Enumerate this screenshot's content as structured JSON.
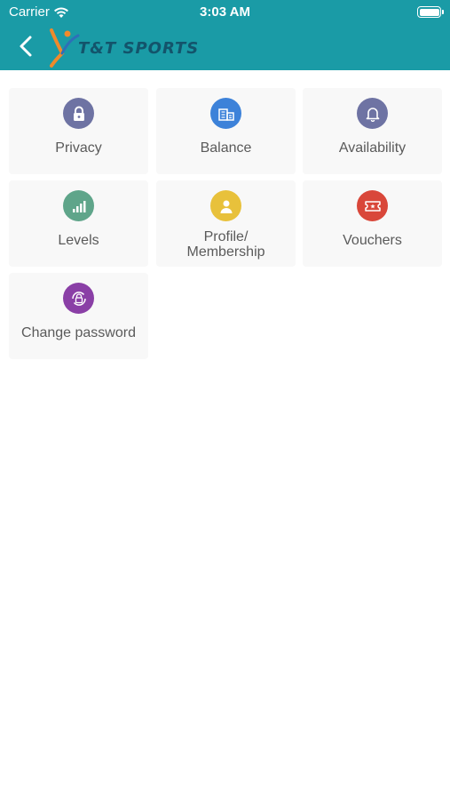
{
  "status_bar": {
    "carrier": "Carrier",
    "time": "3:03 AM"
  },
  "header": {
    "brand": "T&T SPORTS",
    "back_icon": "chevron-left-icon",
    "background_color": "#1a9ba6"
  },
  "tiles": [
    {
      "label": "Privacy",
      "icon": "lock-icon",
      "color": "#6e73a3"
    },
    {
      "label": "Balance",
      "icon": "building-icon",
      "color": "#3d82d9"
    },
    {
      "label": "Availability",
      "icon": "bell-icon",
      "color": "#6e73a3"
    },
    {
      "label": "Levels",
      "icon": "signal-bars-icon",
      "color": "#5fa58a"
    },
    {
      "label": "Profile/",
      "label2": "Membership",
      "icon": "person-icon",
      "color": "#e8c13b"
    },
    {
      "label": "Vouchers",
      "icon": "ticket-icon",
      "color": "#d9473a"
    },
    {
      "label": "Change password",
      "icon": "lock-refresh-icon",
      "color": "#8a3fa6"
    }
  ]
}
